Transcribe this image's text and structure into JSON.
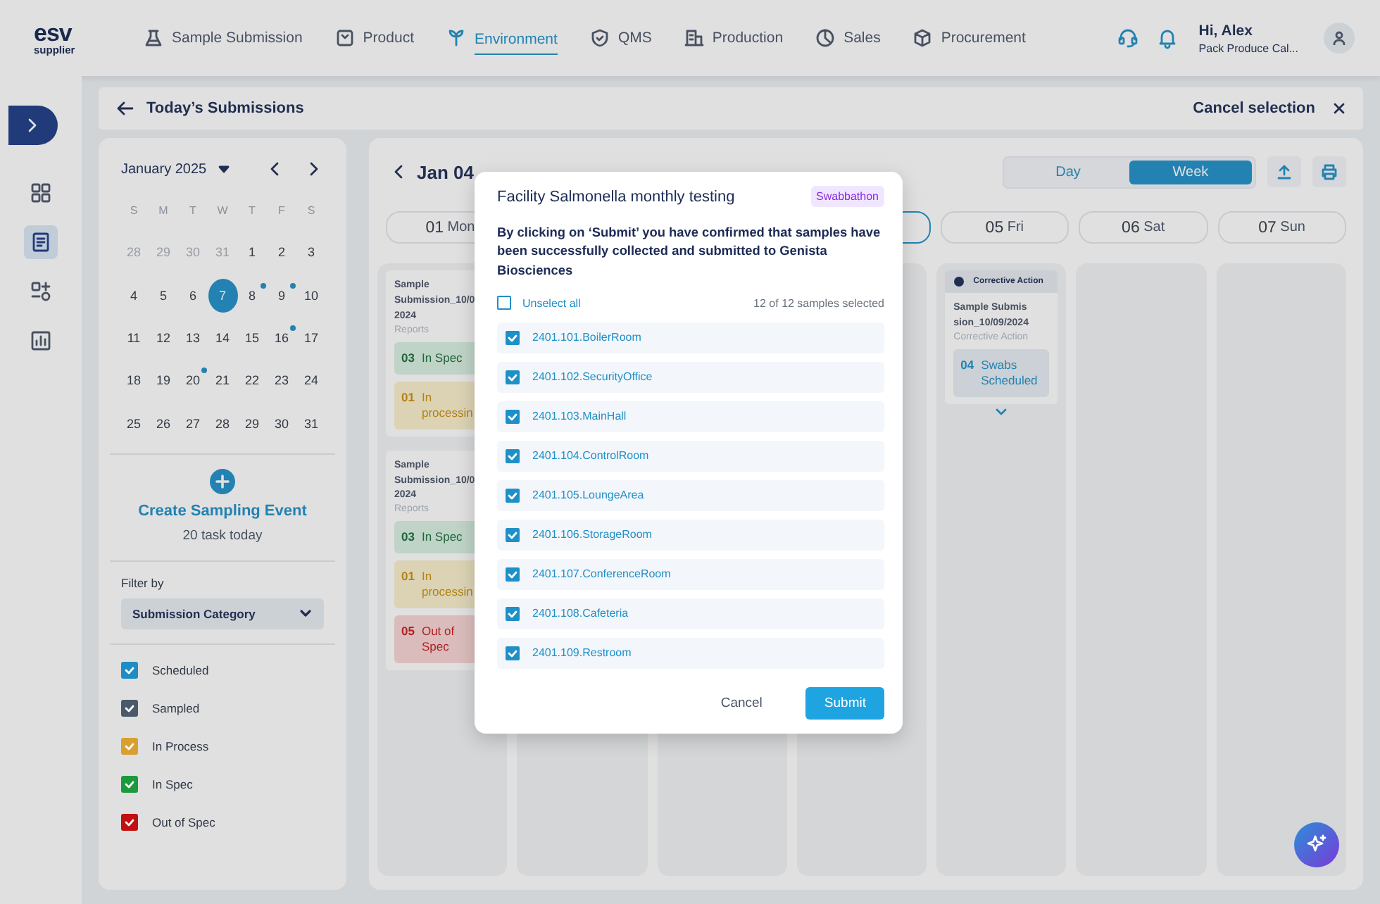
{
  "logo": {
    "brand": "esv",
    "sub": "supplier"
  },
  "nav": [
    {
      "label": "Sample Submission",
      "selected": false
    },
    {
      "label": "Product",
      "selected": false
    },
    {
      "label": "Environment",
      "selected": true
    },
    {
      "label": "QMS",
      "selected": false
    },
    {
      "label": "Production",
      "selected": false
    },
    {
      "label": "Sales",
      "selected": false
    },
    {
      "label": "Procurement",
      "selected": false
    }
  ],
  "user": {
    "greeting": "Hi, Alex",
    "company": "Pack Produce Cal..."
  },
  "rail": [
    {
      "selected": false
    },
    {
      "selected": true
    },
    {
      "selected": false
    },
    {
      "selected": false
    }
  ],
  "page_title": "Today’s Submissions",
  "cancel_selection": "Cancel selection",
  "calendar": {
    "month": "January 2025",
    "weekdays": [
      "S",
      "M",
      "T",
      "W",
      "T",
      "F",
      "S"
    ],
    "weeks": [
      [
        {
          "d": "28",
          "muted": true,
          "selected": false,
          "dot": false
        },
        {
          "d": "29",
          "muted": true,
          "selected": false,
          "dot": false
        },
        {
          "d": "30",
          "muted": true,
          "selected": false,
          "dot": false
        },
        {
          "d": "31",
          "muted": true,
          "selected": false,
          "dot": false
        },
        {
          "d": "1",
          "muted": false,
          "selected": false,
          "dot": false
        },
        {
          "d": "2",
          "muted": false,
          "selected": false,
          "dot": false
        },
        {
          "d": "3",
          "muted": false,
          "selected": false,
          "dot": false
        }
      ],
      [
        {
          "d": "4",
          "muted": false,
          "selected": false,
          "dot": false
        },
        {
          "d": "5",
          "muted": false,
          "selected": false,
          "dot": false
        },
        {
          "d": "6",
          "muted": false,
          "selected": false,
          "dot": false
        },
        {
          "d": "7",
          "muted": false,
          "selected": true,
          "dot": false
        },
        {
          "d": "8",
          "muted": false,
          "selected": false,
          "dot": true
        },
        {
          "d": "9",
          "muted": false,
          "selected": false,
          "dot": true
        },
        {
          "d": "10",
          "muted": false,
          "selected": false,
          "dot": false
        }
      ],
      [
        {
          "d": "11",
          "muted": false,
          "selected": false,
          "dot": false
        },
        {
          "d": "12",
          "muted": false,
          "selected": false,
          "dot": false
        },
        {
          "d": "13",
          "muted": false,
          "selected": false,
          "dot": false
        },
        {
          "d": "14",
          "muted": false,
          "selected": false,
          "dot": false
        },
        {
          "d": "15",
          "muted": false,
          "selected": false,
          "dot": false
        },
        {
          "d": "16",
          "muted": false,
          "selected": false,
          "dot": true
        },
        {
          "d": "17",
          "muted": false,
          "selected": false,
          "dot": false
        }
      ],
      [
        {
          "d": "18",
          "muted": false,
          "selected": false,
          "dot": false
        },
        {
          "d": "19",
          "muted": false,
          "selected": false,
          "dot": false
        },
        {
          "d": "20",
          "muted": false,
          "selected": false,
          "dot": true
        },
        {
          "d": "21",
          "muted": false,
          "selected": false,
          "dot": false
        },
        {
          "d": "22",
          "muted": false,
          "selected": false,
          "dot": false
        },
        {
          "d": "23",
          "muted": false,
          "selected": false,
          "dot": false
        },
        {
          "d": "24",
          "muted": false,
          "selected": false,
          "dot": false
        }
      ],
      [
        {
          "d": "25",
          "muted": false,
          "selected": false,
          "dot": false
        },
        {
          "d": "26",
          "muted": false,
          "selected": false,
          "dot": false
        },
        {
          "d": "27",
          "muted": false,
          "selected": false,
          "dot": false
        },
        {
          "d": "28",
          "muted": false,
          "selected": false,
          "dot": false
        },
        {
          "d": "29",
          "muted": false,
          "selected": false,
          "dot": false
        },
        {
          "d": "30",
          "muted": false,
          "selected": false,
          "dot": false
        },
        {
          "d": "31",
          "muted": false,
          "selected": false,
          "dot": false
        }
      ]
    ]
  },
  "create_event": {
    "label": "Create Sampling Event",
    "tasks": "20 task today"
  },
  "filter": {
    "label": "Filter by",
    "dropdown": "Submission Category",
    "options": [
      {
        "label": "Scheduled",
        "checked": true,
        "color": "#1f8cc4"
      },
      {
        "label": "Sampled",
        "checked": true,
        "color": "#4a5a6c"
      },
      {
        "label": "In Process",
        "checked": true,
        "color": "#d8a030"
      },
      {
        "label": "In Spec",
        "checked": true,
        "color": "#1a9a3c"
      },
      {
        "label": "Out of Spec",
        "checked": true,
        "color": "#c01010"
      }
    ]
  },
  "week": {
    "date": "Jan 04",
    "views": [
      {
        "label": "Day",
        "selected": false
      },
      {
        "label": "Week",
        "selected": true
      }
    ],
    "days": [
      {
        "num": "01",
        "name": "Mon",
        "selected": false
      },
      {
        "selected": true
      },
      {
        "num": "05",
        "name": "Fri",
        "selected": false
      },
      {
        "num": "06",
        "name": "Sat",
        "selected": false
      },
      {
        "num": "07",
        "name": "Sun",
        "selected": false
      }
    ],
    "columns": [
      {
        "cards": [
          {
            "title": "Sample Submission_10/0 2024",
            "subtitle": "Reports",
            "chips": [
              {
                "kind": "in_spec",
                "count": "03",
                "label": "In Spec"
              },
              {
                "kind": "in_process",
                "count": "01",
                "label": "In processin"
              }
            ]
          },
          {
            "title": "Sample Submission_10/0 2024",
            "subtitle": "Reports",
            "chips": [
              {
                "kind": "in_spec",
                "count": "03",
                "label": "In Spec"
              },
              {
                "kind": "in_process",
                "count": "01",
                "label": "In processin"
              },
              {
                "kind": "out_of_spec",
                "count": "05",
                "label": "Out of Spec"
              }
            ]
          }
        ]
      },
      {},
      {},
      {},
      {
        "cards": [
          {
            "header": "Corrective Action",
            "title": "Sample Submission_10/09/2024",
            "subtitle": "Corrective Action",
            "expandable": true,
            "chips": [
              {
                "kind": "scheduled",
                "count": "04",
                "label": "Swabs Scheduled"
              }
            ]
          }
        ]
      },
      {},
      {}
    ]
  },
  "dialog": {
    "title": "Facility Salmonella monthly testing",
    "tag": "Swabbathon",
    "message": "By clicking on ‘Submit’ you have confirmed that samples have been successfully collected and submitted to Genista Biosciences",
    "unselect": {
      "label": "Unselect all",
      "checked": false
    },
    "count": "12 of 12 samples selected",
    "samples": [
      {
        "label": "2401.101.BoilerRoom",
        "checked": true
      },
      {
        "label": "2401.102.SecurityOffice",
        "checked": true
      },
      {
        "label": "2401.103.MainHall",
        "checked": true
      },
      {
        "label": "2401.104.ControlRoom",
        "checked": true
      },
      {
        "label": "2401.105.LoungeArea",
        "checked": true
      },
      {
        "label": "2401.106.StorageRoom",
        "checked": true
      },
      {
        "label": "2401.107.ConferenceRoom",
        "checked": true
      },
      {
        "label": "2401.108.Cafeteria",
        "checked": true
      },
      {
        "label": "2401.109.Restroom",
        "checked": true
      }
    ],
    "buttons": [
      {
        "kind": "secondary",
        "label": "Cancel"
      },
      {
        "kind": "primary",
        "label": "Submit"
      }
    ]
  }
}
